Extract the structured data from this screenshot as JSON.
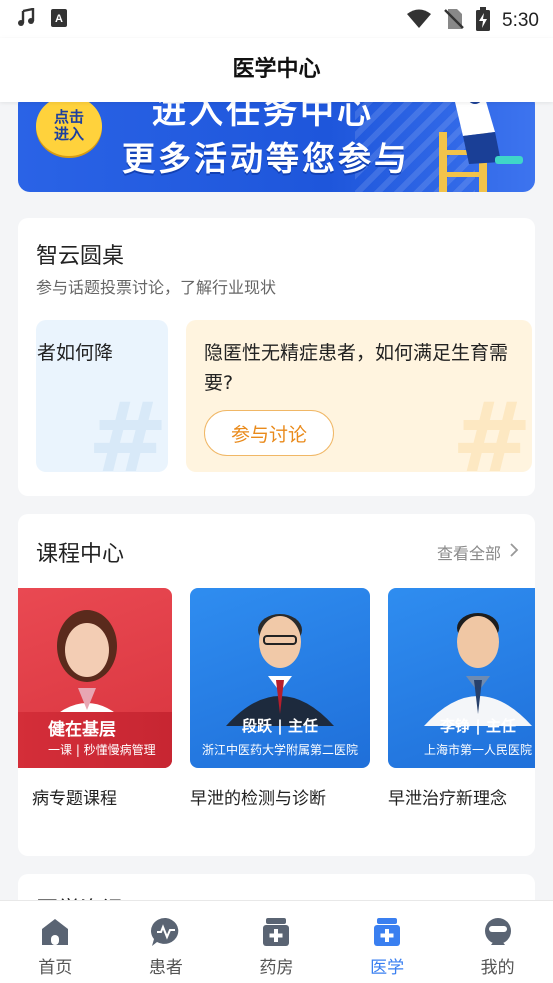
{
  "status_bar": {
    "time": "5:30",
    "icons": [
      "music-note-icon",
      "a-icon",
      "wifi-icon",
      "no-sim-icon",
      "battery-charging-icon"
    ]
  },
  "header": {
    "title": "医学中心"
  },
  "banner": {
    "badge": "点击进入",
    "line1": "进入任务中心",
    "line2": "更多活动等您参与"
  },
  "roundtable": {
    "title": "智云圆桌",
    "subtitle": "参与话题投票讨论，了解行业现状",
    "topics": [
      {
        "text": "患者如何降"
      },
      {
        "text": "隐匿性无精症患者，如何满足生育需要?",
        "button": "参与讨论"
      }
    ]
  },
  "course_center": {
    "title": "课程中心",
    "more": "查看全部",
    "courses": [
      {
        "thumb_name": "健在基层",
        "thumb_sub": "一课 | 秒懂慢病管理",
        "title": "病专题课程"
      },
      {
        "thumb_name": "段跃 | 主任",
        "thumb_sub": "浙江中医药大学附属第二医院",
        "title": "早泄的检测与诊断"
      },
      {
        "thumb_name": "李铮 | 主任",
        "thumb_sub": "上海市第一人民医院",
        "title": "早泄治疗新理念"
      }
    ]
  },
  "news": {
    "title": "医学资讯"
  },
  "tabbar": {
    "items": [
      {
        "label": "首页",
        "icon": "home-icon"
      },
      {
        "label": "患者",
        "icon": "patient-chat-icon"
      },
      {
        "label": "药房",
        "icon": "pharmacy-icon"
      },
      {
        "label": "医学",
        "icon": "medicine-box-icon",
        "active": true
      },
      {
        "label": "我的",
        "icon": "profile-icon"
      }
    ],
    "active_color": "#3a7ff0"
  }
}
